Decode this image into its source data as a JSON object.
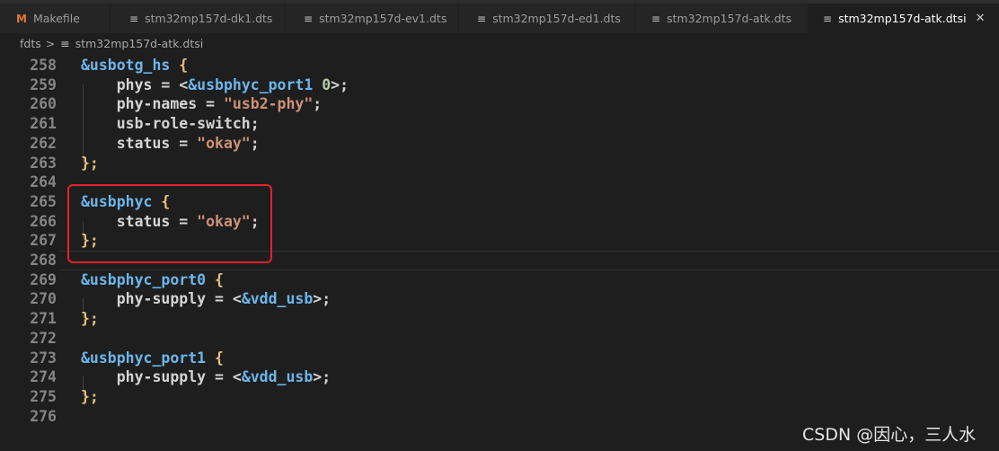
{
  "tabs": [
    {
      "label": "Makefile",
      "icon": "makefile-m-icon",
      "active": false
    },
    {
      "label": "stm32mp157d-dk1.dts",
      "icon": "text-lines-icon",
      "active": false
    },
    {
      "label": "stm32mp157d-ev1.dts",
      "icon": "text-lines-icon",
      "active": false
    },
    {
      "label": "stm32mp157d-ed1.dts",
      "icon": "text-lines-icon",
      "active": false
    },
    {
      "label": "stm32mp157d-atk.dts",
      "icon": "text-lines-icon",
      "active": false
    },
    {
      "label": "stm32mp157d-atk.dtsi",
      "icon": "text-lines-icon",
      "active": true
    }
  ],
  "breadcrumb": {
    "folder": "fdts",
    "separator": ">",
    "file": "stm32mp157d-atk.dtsi"
  },
  "editor": {
    "current_line": 268,
    "lines": [
      {
        "n": "258",
        "tokens": [
          [
            "&usbotg_hs",
            "node"
          ],
          [
            " ",
            "plain"
          ],
          [
            "{",
            "brace"
          ]
        ]
      },
      {
        "n": "259",
        "tokens": [
          [
            "    phys = <",
            "plain"
          ],
          [
            "&usbphyc_port1",
            "ref"
          ],
          [
            " ",
            "plain"
          ],
          [
            "0",
            "num"
          ],
          [
            ">;",
            "plain"
          ]
        ]
      },
      {
        "n": "260",
        "tokens": [
          [
            "    phy-names = ",
            "plain"
          ],
          [
            "\"usb2-phy\"",
            "str"
          ],
          [
            ";",
            "plain"
          ]
        ]
      },
      {
        "n": "261",
        "tokens": [
          [
            "    usb-role-switch;",
            "plain"
          ]
        ]
      },
      {
        "n": "262",
        "tokens": [
          [
            "    status = ",
            "plain"
          ],
          [
            "\"okay\"",
            "str"
          ],
          [
            ";",
            "plain"
          ]
        ]
      },
      {
        "n": "263",
        "tokens": [
          [
            "};",
            "brace"
          ]
        ]
      },
      {
        "n": "264",
        "tokens": []
      },
      {
        "n": "265",
        "tokens": [
          [
            "&usbphyc",
            "node"
          ],
          [
            " ",
            "plain"
          ],
          [
            "{",
            "brace"
          ]
        ]
      },
      {
        "n": "266",
        "tokens": [
          [
            "    status = ",
            "plain"
          ],
          [
            "\"okay\"",
            "str"
          ],
          [
            ";",
            "plain"
          ]
        ]
      },
      {
        "n": "267",
        "tokens": [
          [
            "};",
            "brace"
          ]
        ]
      },
      {
        "n": "268",
        "tokens": []
      },
      {
        "n": "269",
        "tokens": [
          [
            "&usbphyc_port0",
            "node"
          ],
          [
            " ",
            "plain"
          ],
          [
            "{",
            "brace"
          ]
        ]
      },
      {
        "n": "270",
        "tokens": [
          [
            "    phy-supply = <",
            "plain"
          ],
          [
            "&vdd_usb",
            "ref"
          ],
          [
            ">;",
            "plain"
          ]
        ]
      },
      {
        "n": "271",
        "tokens": [
          [
            "};",
            "brace"
          ]
        ]
      },
      {
        "n": "272",
        "tokens": []
      },
      {
        "n": "273",
        "tokens": [
          [
            "&usbphyc_port1",
            "node"
          ],
          [
            " ",
            "plain"
          ],
          [
            "{",
            "brace"
          ]
        ]
      },
      {
        "n": "274",
        "tokens": [
          [
            "    phy-supply = <",
            "plain"
          ],
          [
            "&vdd_usb",
            "ref"
          ],
          [
            ">;",
            "plain"
          ]
        ]
      },
      {
        "n": "275",
        "tokens": [
          [
            "};",
            "brace"
          ]
        ]
      },
      {
        "n": "276",
        "tokens": []
      }
    ]
  },
  "annotation_box": {
    "color": "#e5212d",
    "covers_lines": [
      "265",
      "266",
      "267"
    ]
  },
  "watermark": "CSDN @因心，三人水",
  "colors": {
    "node": "#6cb6ea",
    "ref": "#6cb6ea",
    "plain": "#d4d4d4",
    "brace": "#e5c07b",
    "str": "#ce9178",
    "num": "#b5cea8",
    "line_number": "#858585",
    "background": "#1e1e1e"
  }
}
